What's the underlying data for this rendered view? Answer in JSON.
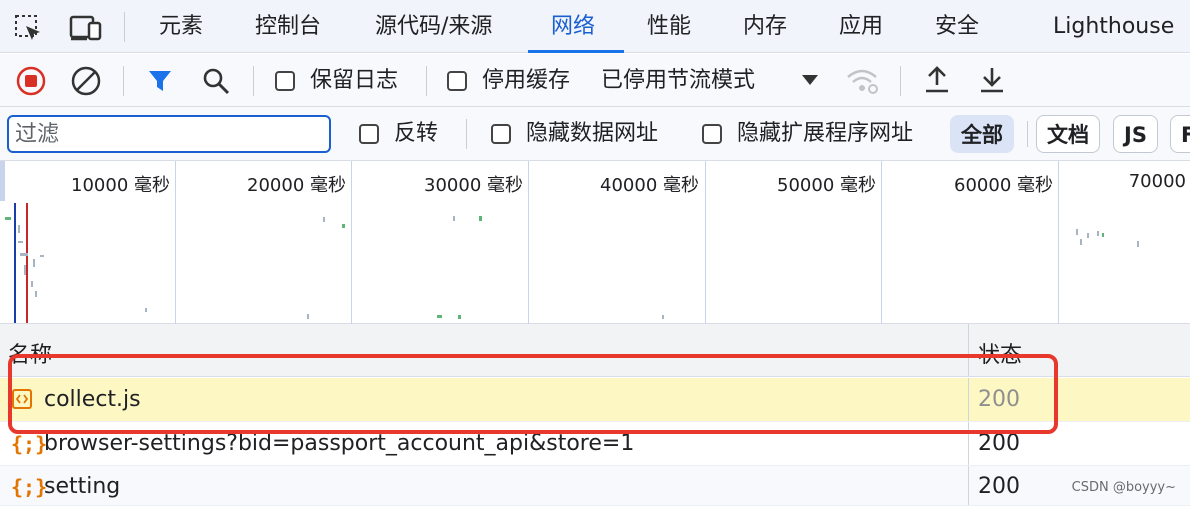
{
  "tabs": [
    "元素",
    "控制台",
    "源代码/来源",
    "网络",
    "性能",
    "内存",
    "应用",
    "安全",
    "Lighthouse"
  ],
  "active_tab": "网络",
  "toolbar": {
    "preserve_log": "保留日志",
    "disable_cache": "停用缓存",
    "throttle": "已停用节流模式"
  },
  "filter": {
    "placeholder": "过滤",
    "invert": "反转",
    "hide_data_urls": "隐藏数据网址",
    "hide_ext_urls": "隐藏扩展程序网址",
    "types": [
      "全部",
      "文档",
      "JS",
      "F"
    ],
    "active_type": "全部"
  },
  "overview": {
    "ticks": [
      "10000 毫秒",
      "20000 毫秒",
      "30000 毫秒",
      "40000 毫秒",
      "50000 毫秒",
      "60000 毫秒",
      "70000"
    ]
  },
  "table": {
    "headers": {
      "name": "名称",
      "status": "状态"
    },
    "rows": [
      {
        "icon": "script-icon",
        "name": "collect.js",
        "status": "200",
        "selected": true
      },
      {
        "icon": "json-icon",
        "name": "browser-settings?bid=passport_account_api&store=1",
        "status": "200",
        "selected": false
      },
      {
        "icon": "json-icon",
        "name": "setting",
        "status": "200",
        "selected": false
      }
    ]
  },
  "watermark": "CSDN @boyyy~",
  "colors": {
    "accent": "#1a73e8",
    "record": "#d93025",
    "highlight_row": "#fdf7c3",
    "annotation": "#e8372c",
    "file_icon": "#e37400"
  }
}
